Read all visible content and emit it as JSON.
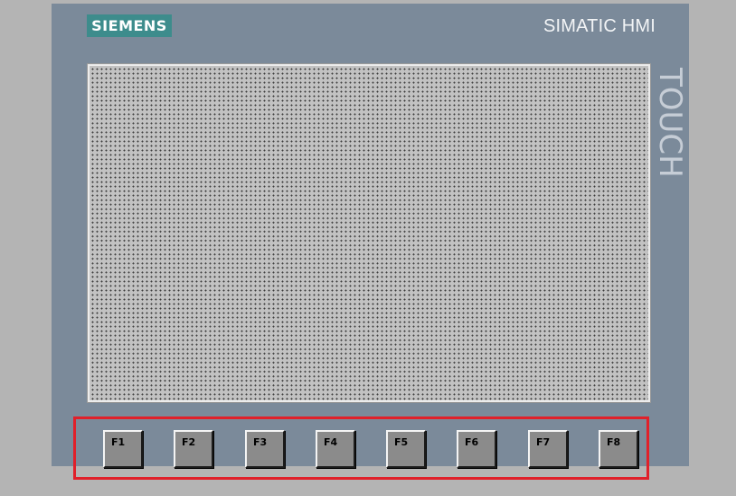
{
  "brand": {
    "logo_text": "SIEMENS",
    "model_title": "SIMATIC HMI",
    "side_label": "TOUCH"
  },
  "colors": {
    "page_background": "#b4b4b4",
    "panel_frame": "#7b8a9a",
    "logo_background": "#3d8c8c",
    "screen_background": "#c2c2c2",
    "highlight_border": "#e0202a",
    "function_key": "#8b8b8b"
  },
  "function_keys": [
    {
      "label": "F1"
    },
    {
      "label": "F2"
    },
    {
      "label": "F3"
    },
    {
      "label": "F4"
    },
    {
      "label": "F5"
    },
    {
      "label": "F6"
    },
    {
      "label": "F7"
    },
    {
      "label": "F8"
    }
  ]
}
